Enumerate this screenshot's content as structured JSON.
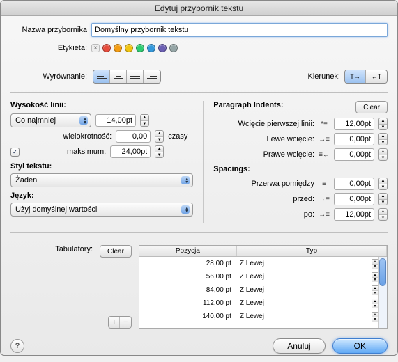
{
  "window": {
    "title": "Edytuj przybornik tekstu"
  },
  "name_row": {
    "label": "Nazwa przybornika",
    "value": "Domyślny przybornik tekstu"
  },
  "etykieta": {
    "label": "Etykieta:",
    "colors": [
      "#e74c3c",
      "#f39c12",
      "#f1c40f",
      "#2ecc71",
      "#3498db",
      "#6b5fb3",
      "#95a5a6"
    ]
  },
  "alignment": {
    "label": "Wyrównanie:"
  },
  "direction": {
    "label": "Kierunek:",
    "ltr": "T→",
    "rtl": "←T"
  },
  "left": {
    "line_height_title": "Wysokość linii:",
    "mode": "Co najmniej",
    "height": "14,00pt",
    "mult_label": "wielokrotność:",
    "mult_value": "0,00",
    "mult_unit": "czasy",
    "max_label": "maksimum:",
    "max_value": "24,00pt",
    "style_title": "Styl tekstu:",
    "style_value": "Żaden",
    "lang_title": "Język:",
    "lang_value": "Użyj domyślnej wartości"
  },
  "right": {
    "indents_title": "Paragraph Indents:",
    "clear": "Clear",
    "first_line": "Wcięcie pierwszej linii:",
    "first_line_val": "12,00pt",
    "left_indent": "Lewe wcięcie:",
    "left_indent_val": "0,00pt",
    "right_indent": "Prawe wcięcie:",
    "right_indent_val": "0,00pt",
    "spacings_title": "Spacings:",
    "between": "Przerwa pomiędzy",
    "between_val": "0,00pt",
    "before": "przed:",
    "before_val": "0,00pt",
    "after": "po:",
    "after_val": "12,00pt"
  },
  "tabs": {
    "label": "Tabulatory:",
    "clear": "Clear",
    "col_pos": "Pozycja",
    "col_type": "Typ",
    "rows": [
      {
        "pos": "28,00 pt",
        "type": "Z Lewej"
      },
      {
        "pos": "56,00 pt",
        "type": "Z Lewej"
      },
      {
        "pos": "84,00 pt",
        "type": "Z Lewej"
      },
      {
        "pos": "112,00 pt",
        "type": "Z Lewej"
      },
      {
        "pos": "140,00 pt",
        "type": "Z Lewej"
      }
    ]
  },
  "footer": {
    "cancel": "Anuluj",
    "ok": "OK"
  }
}
